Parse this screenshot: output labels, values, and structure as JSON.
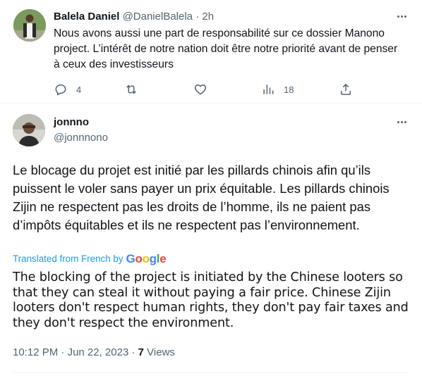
{
  "reply_tweet": {
    "author_name": "Balela Daniel",
    "author_handle": "@DanielBalela",
    "separator": "·",
    "time_ago": "2h",
    "text": "Nous avons aussi une part de responsabilité sur ce dossier Manono project. L’intérêt de notre nation doit être notre priorité avant de penser à ceux des investisseurs",
    "actions": {
      "reply_count": "4",
      "retweet_count": "",
      "like_count": "",
      "views_count": "18"
    }
  },
  "main_tweet": {
    "author_name": "jonnno",
    "author_handle": "@jonnnono",
    "text": "Le blocage du projet est initié par les pillards chinois afin qu’ils puissent le voler sans payer un prix équitable. Les pillards chinois Zijin ne respectent pas les droits de l’homme, ils ne paient pas d’impôts équitables et ils ne respectent pas l’environnement.",
    "translation_label": "Translated from French by",
    "translation_provider": "Google",
    "translation_text": "The blocking of the project is initiated by the Chinese looters so that they can steal it without paying a fair price. Chinese Zijin looters don't respect human rights, they don't pay fair taxes and they don't respect the environment.",
    "time": "10:12 PM",
    "separator": "·",
    "date": "Jun 22, 2023",
    "views_count": "7",
    "views_label": "Views"
  },
  "icons": {
    "more": "more-horizontal-icon",
    "reply": "reply-bubble-icon",
    "retweet": "retweet-icon",
    "like": "heart-icon",
    "views": "views-bar-chart-icon",
    "share": "share-upload-icon"
  },
  "colors": {
    "text_primary": "#0f1419",
    "text_secondary": "#536471",
    "link_blue": "#1d9bf0",
    "divider": "#eff3f4"
  }
}
